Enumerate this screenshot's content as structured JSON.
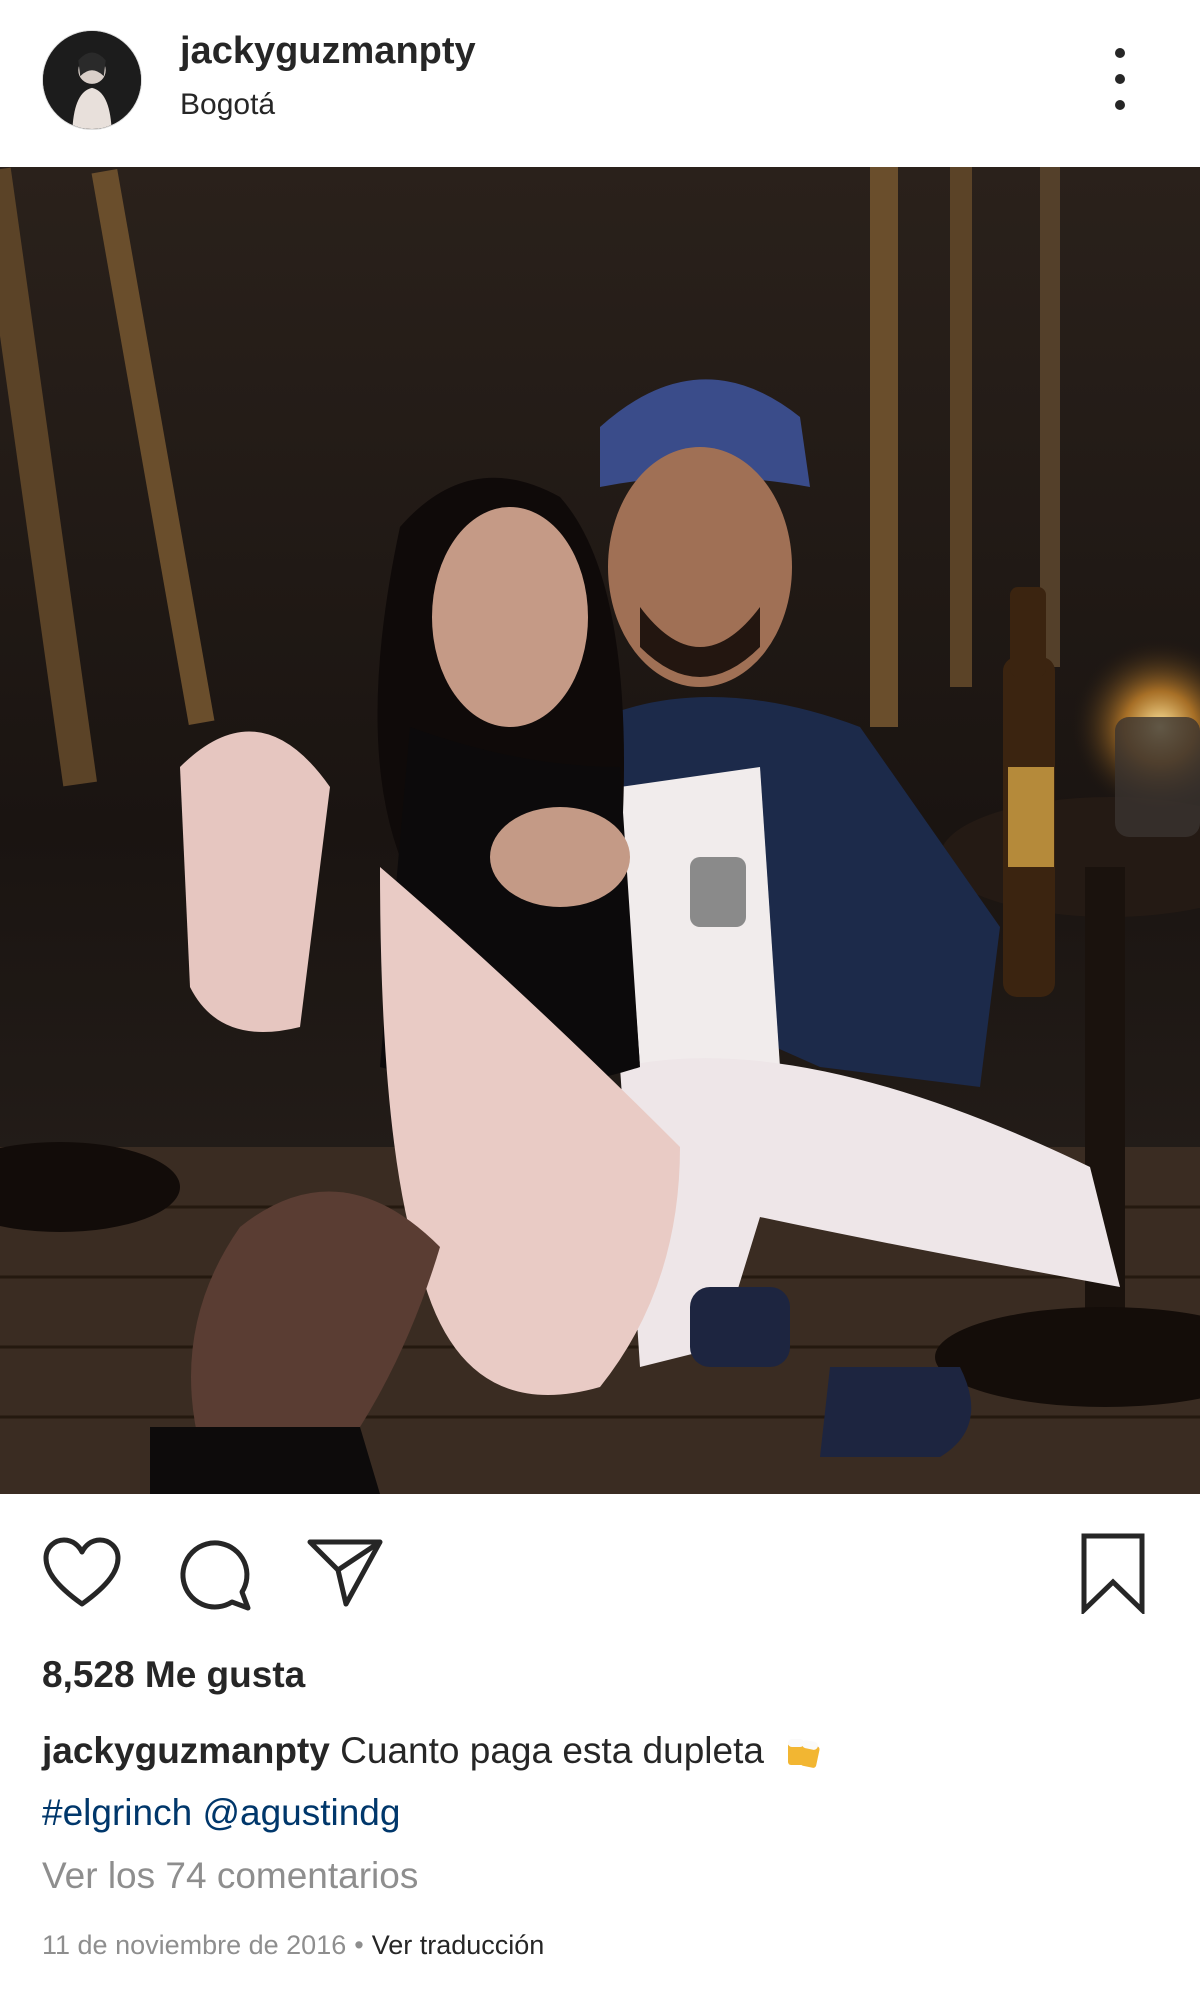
{
  "post": {
    "username": "jackyguzmanpty",
    "location": "Bogotá",
    "likes_text": "8,528 Me gusta",
    "caption_user": "jackyguzmanpty",
    "caption_text": "Cuanto paga esta dupleta",
    "caption_emoji": "beer-mugs-emoji",
    "hashtag": "#elgrinch",
    "mention": "@agustindg",
    "view_comments": "Ver los 74 comentarios",
    "date": "11 de noviembre de 2016",
    "separator": "•",
    "translate": "Ver traducción"
  },
  "icons": {
    "more": "more-vertical-icon",
    "like": "heart-icon",
    "comment": "comment-icon",
    "share": "paper-plane-icon",
    "save": "bookmark-icon"
  },
  "colors": {
    "text": "#262626",
    "secondary": "#8e8e8e",
    "link": "#00376b"
  }
}
